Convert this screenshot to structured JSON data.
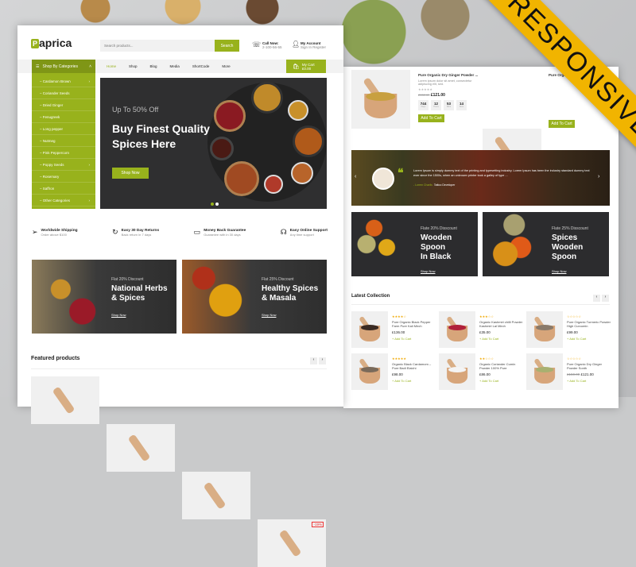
{
  "brand": {
    "logo_letter": "P",
    "name": "aprica",
    "accent": "#98b21c",
    "ribbon_color": "#f1b400"
  },
  "ribbon": "RESPONSIVE",
  "header": {
    "search_placeholder": "Search products...",
    "search_button": "Search",
    "call_label": "Call Now:",
    "call_number": "2-100-56-55",
    "account_label": "My Account",
    "account_sub": "Sign In Register"
  },
  "nav": {
    "categories_label": "Shop By Categories",
    "items": [
      "Home",
      "Shop",
      "Blog",
      "Media",
      "ShortCode",
      "More"
    ],
    "cart_label": "My Cart",
    "cart_total": "£0.00",
    "cart_count": "0"
  },
  "categories": [
    {
      "label": "Cardamon Brown",
      "arrow": true
    },
    {
      "label": "Coriander Seeds"
    },
    {
      "label": "Dried Ginger"
    },
    {
      "label": "Fenugreek"
    },
    {
      "label": "Long pepper"
    },
    {
      "label": "Nutmeg"
    },
    {
      "label": "Pink Peppercorn"
    },
    {
      "label": "Poppy Seeds",
      "arrow": true
    },
    {
      "label": "Rosemary"
    },
    {
      "label": "Saffron"
    },
    {
      "label": "Other Categories",
      "arrow": true
    }
  ],
  "hero": {
    "subtitle": "Up To 50% Off",
    "title_line1": "Buy Finest Quality",
    "title_line2": "Spices Here",
    "button": "Shop Now"
  },
  "features": [
    {
      "icon": "send-icon",
      "title": "Worldwide Shipping",
      "sub": "Order above $100"
    },
    {
      "icon": "returns-icon",
      "title": "Easy 30 Day Returns",
      "sub": "Back return in 7 days"
    },
    {
      "icon": "wallet-icon",
      "title": "Money Back Guarantee",
      "sub": "Guarantee with in 30 days"
    },
    {
      "icon": "headset-icon",
      "title": "Easy Online Support",
      "sub": "Any time support"
    }
  ],
  "banners": [
    {
      "sub": "Flat 20% Discount",
      "l1": "National Herbs",
      "l2": "& Spices",
      "link": "Shop Now"
    },
    {
      "sub": "Flat 25% Discount",
      "l1": "Healthy Spices",
      "l2": "& Masala",
      "link": "Shop Now"
    }
  ],
  "featured": {
    "title": "Featured products",
    "badge": "-19%"
  },
  "deal": {
    "title": "Pure Organic Dry Ginger Powder ...",
    "title2": "Pure Organic ... Pow...",
    "desc": "Lorem ipsum dolor sit amet, consectetur adipiscing elit, sed.",
    "old_price": "£150.00",
    "price": "£121.00",
    "countdown": [
      {
        "v": "744",
        "u": "Days"
      },
      {
        "v": "12",
        "u": "Hours"
      },
      {
        "v": "53",
        "u": "Mins"
      },
      {
        "v": "14",
        "u": "Secs"
      }
    ],
    "button": "Add To Cart"
  },
  "testimonial": {
    "text": "Lorem Ipsum is simply dummy text of the printing and typesetting industry. Lorem Ipsum has been the industry standard dummy text ever since the 1500s, when an unknown printer took a galley of type ...",
    "name": "- Lorem Charlis",
    "role": "Tattoo Developer"
  },
  "banners2": [
    {
      "sub": "Flate 20% Disscount",
      "l1": "Wooden Spoon",
      "l2": "In Black",
      "link": "Shop Now"
    },
    {
      "sub": "Flate 25% Disscount",
      "l1": "Spices Wooden",
      "l2": "Spoon",
      "link": "Shop Now"
    }
  ],
  "latest": {
    "title": "Latest Collection",
    "add": "+ Add To Cart",
    "items": [
      {
        "stars": "★★★★☆",
        "name": "Pure Organic Black Pepper Farm Pure Kali Mirch",
        "price": "£136.00",
        "color": "#3a2a22"
      },
      {
        "stars": "★★★☆☆",
        "name": "Organic Kashmiri chilli Powder Kashmiri Lal Mirch",
        "price": "£35.00",
        "color": "#b0203a"
      },
      {
        "stars": "☆☆☆☆☆",
        "name": "Pure Organic Turmeric Powder High Curcumin",
        "price": "£99.00",
        "color": "#8a7a6a"
      },
      {
        "stars": "★★★★★",
        "name": "Organic Black Cardamom – Pure Badi Elaichi",
        "price": "£98.00",
        "color": "#7a6a5a"
      },
      {
        "stars": "★★☆☆☆",
        "name": "Organic Coriander Cumin Powder 100% Pure",
        "price": "£86.00",
        "color": "#f4f4f4"
      },
      {
        "stars": "☆☆☆☆☆",
        "name": "Pure Organic Dry Ginger Powder Sonth",
        "old": "£150.00",
        "price": "£121.00",
        "color": "#a8b070"
      }
    ]
  }
}
